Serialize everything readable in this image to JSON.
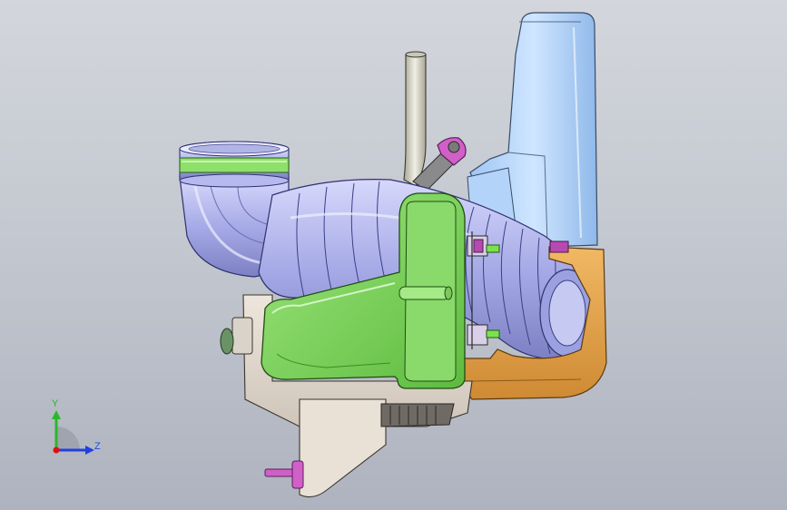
{
  "viewport": {
    "background_top": "#d3d6dc",
    "background_bottom": "#aeb3bf"
  },
  "triad": {
    "y_label": "Y",
    "z_label": "Z",
    "y_color": "#2ab82a",
    "z_color": "#2040e0",
    "origin_color": "#e01010"
  },
  "model": {
    "parts": [
      {
        "name": "air-filter-housing",
        "color": "#b9d8fb"
      },
      {
        "name": "intake-elbow-pipe",
        "color": "#b9bcef"
      },
      {
        "name": "corrugated-intake-hose",
        "color": "#aeb2ea"
      },
      {
        "name": "resonator-chamber",
        "color": "#7fd660"
      },
      {
        "name": "mounting-bracket",
        "color": "#e5a04a"
      },
      {
        "name": "breather-tube",
        "color": "#d8d8c8"
      },
      {
        "name": "support-plate",
        "color": "#e8ddd4"
      },
      {
        "name": "clamp-band",
        "color": "#8fe06a"
      },
      {
        "name": "vacuum-line",
        "color": "#d060c8"
      }
    ]
  }
}
